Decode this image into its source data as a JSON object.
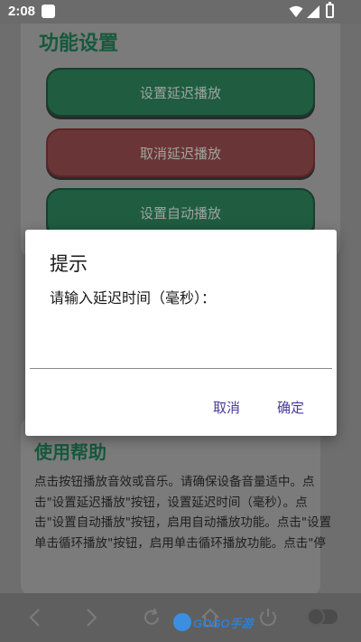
{
  "status_bar": {
    "time": "2:08",
    "icons": [
      "notification-box-icon",
      "wifi-icon",
      "signal-icon",
      "battery-icon"
    ]
  },
  "app": {
    "section_title": "功能设置",
    "buttons": [
      {
        "label": "设置延迟播放",
        "color": "#1f5c40"
      },
      {
        "label": "取消延迟播放",
        "color": "#6a3536"
      },
      {
        "label": "设置自动播放",
        "color": "#1f5c40"
      }
    ],
    "help": {
      "title": "使用帮助",
      "text": "点击按钮播放音效或音乐。请确保设备音量适中。点击\"设置延迟播放\"按钮，设置延迟时间（毫秒）。点击\"设置自动播放\"按钮，启用自动播放功能。点击\"设置单击循环播放\"按钮，启用单击循环播放功能。点击\"停"
    }
  },
  "dialog": {
    "title": "提示",
    "message": "请输入延迟时间（毫秒）：",
    "input_value": "",
    "cancel_label": "取消",
    "confirm_label": "确定",
    "accent_color": "#4a3a9a"
  },
  "navbar": {
    "icons": [
      "back-icon",
      "forward-icon",
      "refresh-icon",
      "home-icon",
      "power-icon",
      "toggle-icon"
    ],
    "watermark": "GOGO手游"
  }
}
